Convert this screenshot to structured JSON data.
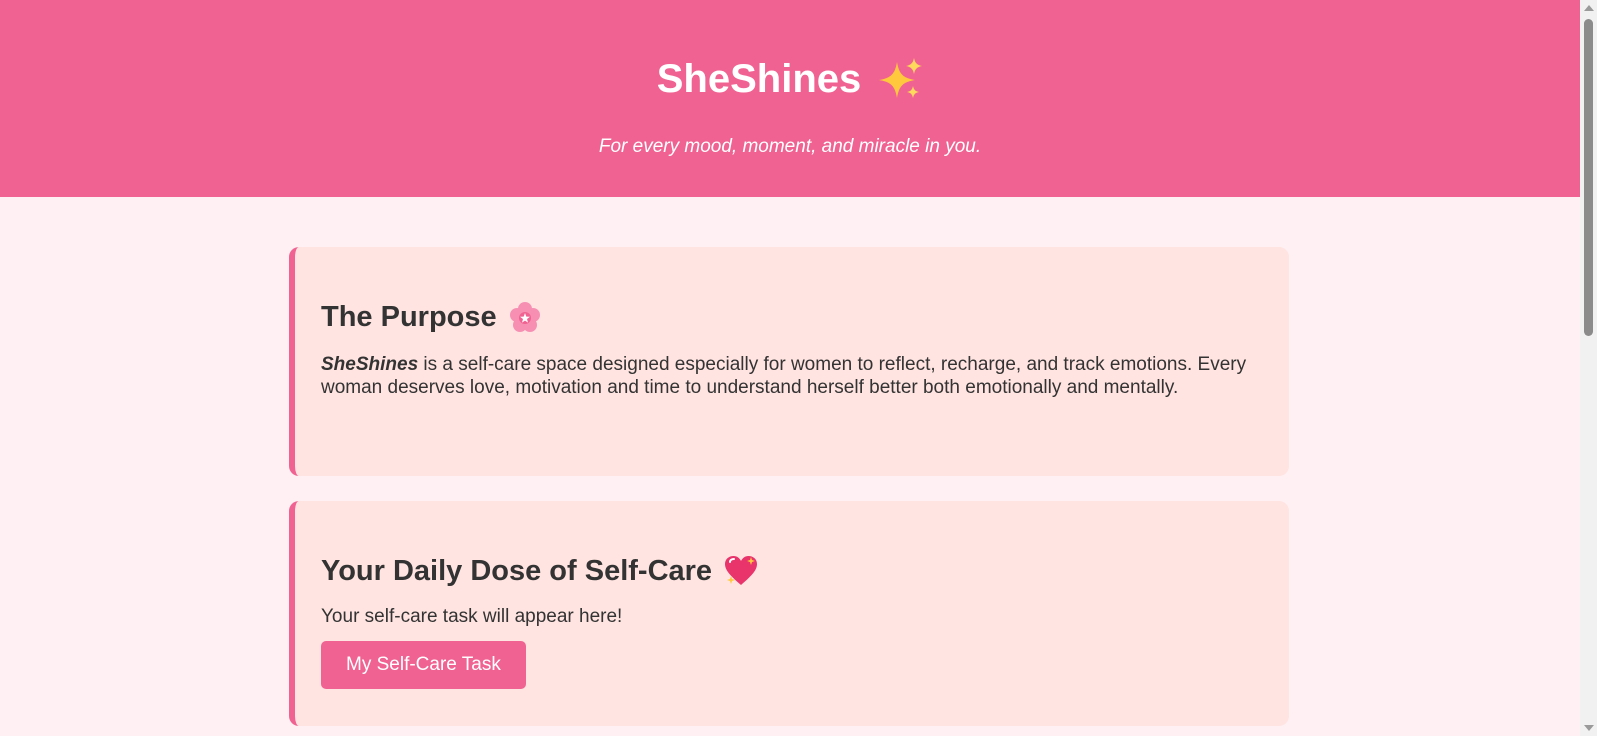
{
  "header": {
    "title": "SheShines",
    "title_emoji": "sparkles-icon",
    "subtitle": "For every mood, moment, and miracle in you."
  },
  "purpose": {
    "heading": "The Purpose",
    "heading_emoji": "cherry-blossom-icon",
    "brand": "SheShines",
    "body": " is a self-care space designed especially for women to reflect, recharge, and track emotions. Every woman deserves love, motivation and time to understand herself better both emotionally and mentally."
  },
  "selfcare": {
    "heading": "Your Daily Dose of Self-Care",
    "heading_emoji": "sparkling-heart-icon",
    "task_text": "Your self-care task will appear here!",
    "button_label": "My Self-Care Task"
  },
  "colors": {
    "accent": "#f06292",
    "page_bg": "#fff0f4",
    "card_bg": "#ffe4e1",
    "text": "#333333"
  }
}
